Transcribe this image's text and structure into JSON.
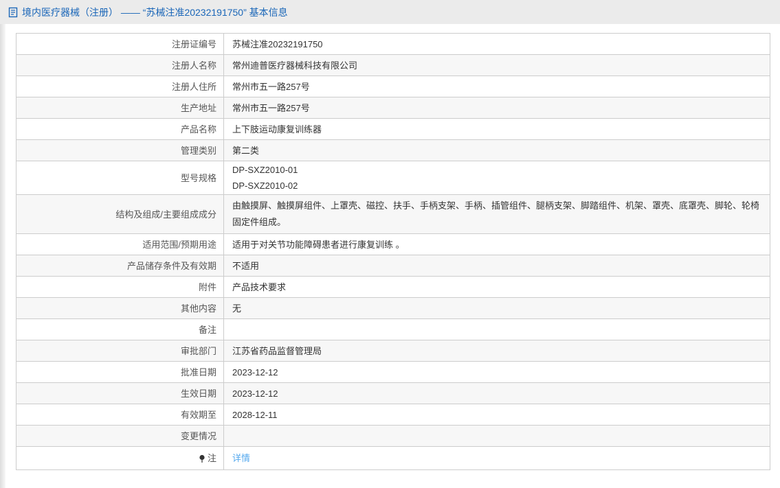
{
  "header": {
    "icon": "document-icon",
    "title": "境内医疗器械（注册） —— “苏械注准20232191750” 基本信息"
  },
  "colors": {
    "title_blue": "#1a66b8",
    "link_blue": "#55a9ee",
    "band_gray": "#ebebeb",
    "alt_row_gray": "#f7f7f7",
    "border_gray": "#cccccc"
  },
  "table": {
    "rows": [
      {
        "label": "注册证编号",
        "value": "苏械注准20232191750"
      },
      {
        "label": "注册人名称",
        "value": "常州迪普医疗器械科技有限公司"
      },
      {
        "label": "注册人住所",
        "value": "常州市五一路257号"
      },
      {
        "label": "生产地址",
        "value": "常州市五一路257号"
      },
      {
        "label": "产品名称",
        "value": "上下肢运动康复训练器"
      },
      {
        "label": "管理类别",
        "value": "第二类"
      },
      {
        "label": "型号规格",
        "lines": [
          "DP-SXZ2010-01",
          "DP-SXZ2010-02"
        ]
      },
      {
        "label": "结构及组成/主要组成成分",
        "value": "由触摸屏、触摸屏组件、上罩壳、磁控、扶手、手柄支架、手柄、插管组件、腿柄支架、脚踏组件、机架、罩壳、底罩壳、脚轮、轮椅固定件组成。"
      },
      {
        "label": "适用范围/预期用途",
        "value": "适用于对关节功能障碍患者进行康复训练 。"
      },
      {
        "label": "产品储存条件及有效期",
        "value": "不适用"
      },
      {
        "label": "附件",
        "value": "产品技术要求"
      },
      {
        "label": "其他内容",
        "value": "无"
      },
      {
        "label": "备注",
        "value": ""
      },
      {
        "label": "审批部门",
        "value": "江苏省药品监督管理局"
      },
      {
        "label": "批准日期",
        "value": "2023-12-12"
      },
      {
        "label": "生效日期",
        "value": "2023-12-12"
      },
      {
        "label": "有效期至",
        "value": "2028-12-11"
      },
      {
        "label": "变更情况",
        "value": ""
      },
      {
        "label": "注",
        "label_icon": "pin-icon",
        "link": "详情"
      }
    ]
  }
}
